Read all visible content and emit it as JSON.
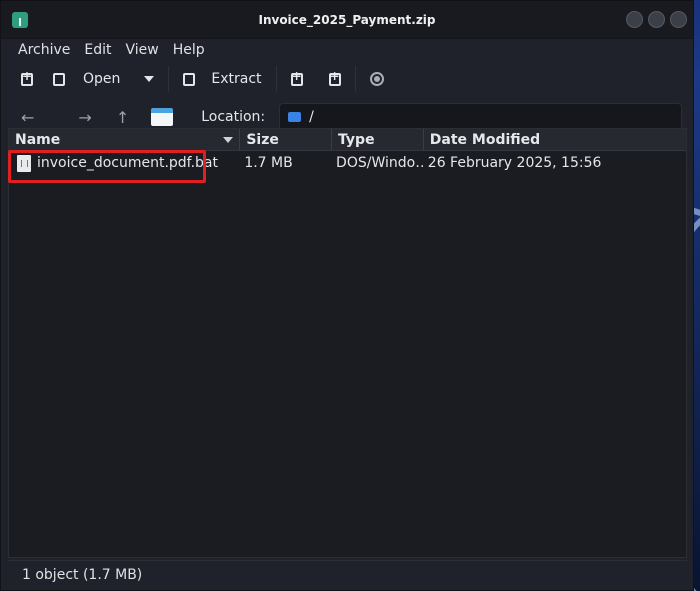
{
  "window": {
    "title": "Invoice_2025_Payment.zip"
  },
  "menu": {
    "items": [
      "Archive",
      "Edit",
      "View",
      "Help"
    ]
  },
  "toolbar": {
    "open_label": "Open",
    "extract_label": "Extract",
    "icons": [
      "new-archive-icon",
      "open-icon",
      "extract-icon",
      "add-file-icon",
      "add-folder-icon",
      "stop-icon"
    ]
  },
  "location": {
    "label": "Location:",
    "path": "/"
  },
  "columns": {
    "name": "Name",
    "size": "Size",
    "type": "Type",
    "date": "Date Modified"
  },
  "files": [
    {
      "name": "invoice_document.pdf.bat",
      "size": "1.7 MB",
      "type": "DOS/Windo…",
      "date": "26 February 2025, 15:56"
    }
  ],
  "status": {
    "text": "1 object (1.7 MB)"
  },
  "colors": {
    "highlight": "#e02020",
    "folder": "#3b82e6",
    "app_icon": "#2f9e7f"
  }
}
